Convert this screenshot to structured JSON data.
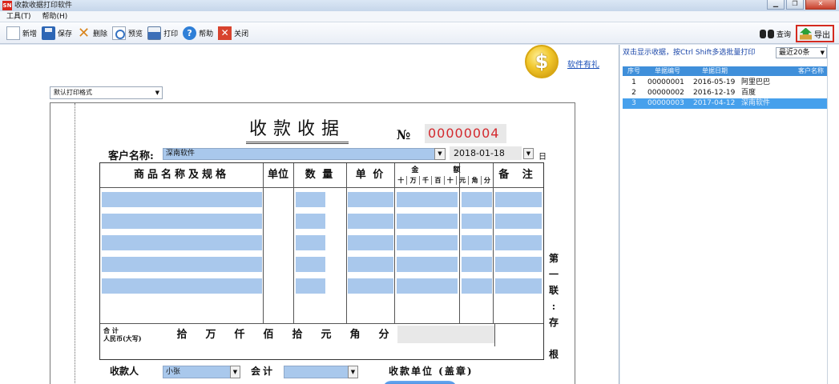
{
  "window": {
    "icon_text": "SN",
    "title": "收款收据打印软件",
    "controls": [
      "▁",
      "❐",
      "✕"
    ]
  },
  "menu": [
    "工具(T)",
    "帮助(H)"
  ],
  "toolbar": {
    "left": [
      {
        "name": "new",
        "label": "新增",
        "icon": "new-document-icon"
      },
      {
        "name": "save",
        "label": "保存",
        "icon": "floppy-disk-icon"
      },
      {
        "name": "delete",
        "label": "删除",
        "icon": "delete-x-icon"
      },
      {
        "name": "preview",
        "label": "预览",
        "icon": "magnifier-icon"
      },
      {
        "name": "print",
        "label": "打印",
        "icon": "printer-icon"
      },
      {
        "name": "help",
        "label": "帮助",
        "icon": "help-icon"
      },
      {
        "name": "close",
        "label": "关闭",
        "icon": "close-icon"
      }
    ],
    "query_label": "查询",
    "export_label": "导出"
  },
  "promo": {
    "coin_symbol": "$",
    "link_text": "软件有礼"
  },
  "print_format": {
    "value": "默认打印格式"
  },
  "receipt": {
    "title": "收款收据",
    "no_label": "№",
    "number": "00000004",
    "customer_label": "客户名称:",
    "customer_value": "深南软件",
    "date_value": "2018-01-18",
    "day_char": "日",
    "headers": {
      "item": "商品名称及规格",
      "unit": "单位",
      "qty": "数 量",
      "price": "单 价",
      "amount": "金 额",
      "amount_units": [
        "十",
        "万",
        "千",
        "百",
        "十",
        "元",
        "角",
        "分"
      ],
      "remark": "备  注"
    },
    "total_label_1": "合 计",
    "total_label_2": "人民币(大写)",
    "total_units": [
      "拾",
      "万",
      "仟",
      "佰",
      "拾",
      "元",
      "角",
      "分"
    ],
    "stub_text": [
      "第",
      "一",
      "联",
      ":",
      "存",
      "",
      "根"
    ],
    "payee_label": "收款人",
    "payee_value": "小张",
    "accountant_label": "会计",
    "unit_seal_label": "收款单位 (盖章)"
  },
  "right_panel": {
    "hint": "双击显示收据，按Ctrl Shift多选批量打印",
    "range_select": "最近20条",
    "columns": [
      "序号",
      "单据编号",
      "单据日期",
      "客户名称"
    ],
    "rows": [
      {
        "seq": "1",
        "no": "00000001",
        "date": "2016-05-19",
        "customer": "阿里巴巴",
        "selected": false
      },
      {
        "seq": "2",
        "no": "00000002",
        "date": "2016-12-19",
        "customer": "百度",
        "selected": false
      },
      {
        "seq": "3",
        "no": "00000003",
        "date": "2017-04-12",
        "customer": "深南软件",
        "selected": true
      }
    ]
  },
  "colors": {
    "field_blue": "#a9c8ec",
    "number_red": "#d4292e",
    "grid_header": "#3f8fda",
    "selected_row": "#46a0ec",
    "export_border": "#d42a1f"
  }
}
